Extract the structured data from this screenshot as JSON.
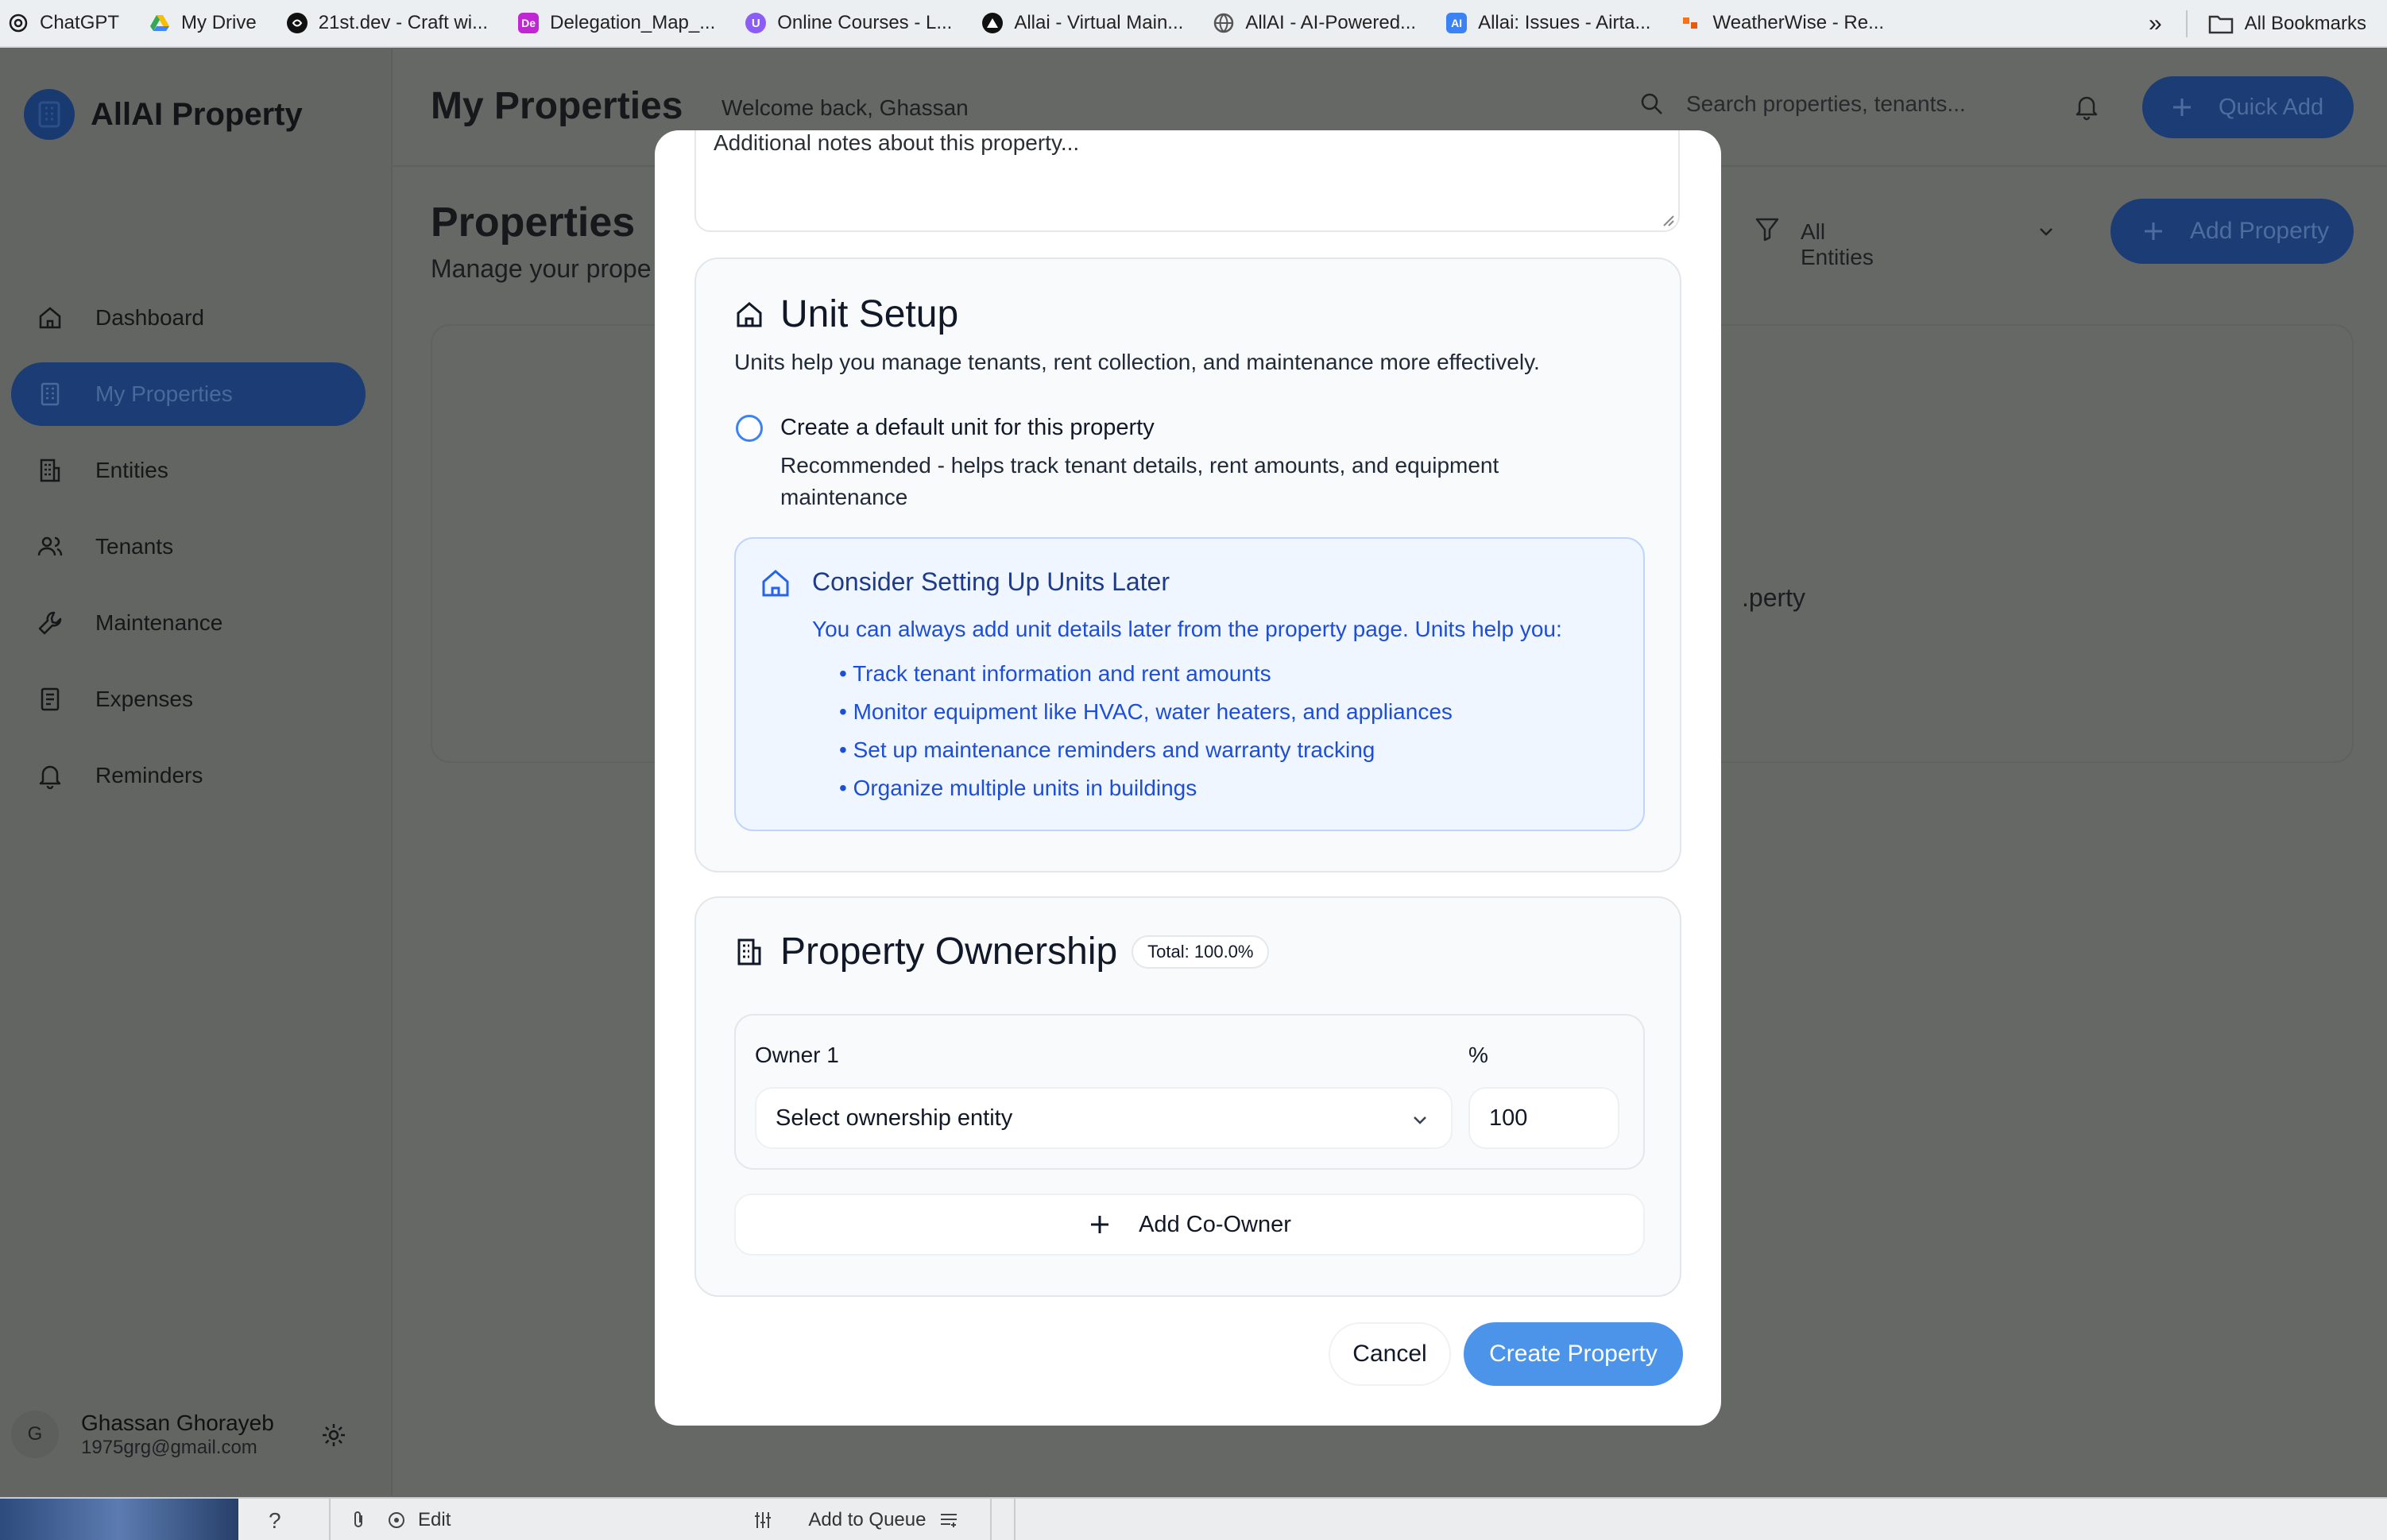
{
  "bookmarks": [
    {
      "label": "ChatGPT",
      "icon": "openai-icon",
      "color": "#1a1a1a"
    },
    {
      "label": "My Drive",
      "icon": "drive-icon",
      "color": "#34a853"
    },
    {
      "label": "21st.dev - Craft wi...",
      "icon": "21st-icon",
      "color": "#111111"
    },
    {
      "label": "Delegation_Map_...",
      "icon": "De",
      "color": "#c026d3"
    },
    {
      "label": "Online Courses - L...",
      "icon": "U",
      "color": "#8b5cf6"
    },
    {
      "label": "Allai - Virtual Main...",
      "icon": "triangle-icon",
      "color": "#111111"
    },
    {
      "label": "AllAI - AI-Powered...",
      "icon": "globe-icon",
      "color": "#555555"
    },
    {
      "label": "Allai: Issues - Airta...",
      "icon": "AI",
      "color": "#3b82f6"
    },
    {
      "label": "WeatherWise - Re...",
      "icon": "weather-icon",
      "color": "#f97316"
    }
  ],
  "bookmarks_more": "»",
  "all_bookmarks": "All Bookmarks",
  "brand": {
    "name": "AllAI Property"
  },
  "nav": [
    {
      "label": "Dashboard",
      "icon": "home-icon"
    },
    {
      "label": "My Properties",
      "icon": "building-icon",
      "active": true
    },
    {
      "label": "Entities",
      "icon": "entities-icon"
    },
    {
      "label": "Tenants",
      "icon": "users-icon"
    },
    {
      "label": "Maintenance",
      "icon": "wrench-icon"
    },
    {
      "label": "Expenses",
      "icon": "receipt-icon"
    },
    {
      "label": "Reminders",
      "icon": "bell-icon"
    }
  ],
  "user": {
    "initial": "G",
    "name": "Ghassan Ghorayeb",
    "email": "1975grg@gmail.com"
  },
  "header": {
    "title": "My Properties",
    "welcome": "Welcome back, Ghassan",
    "search_placeholder": "Search properties, tenants...",
    "quick_add": "Quick Add"
  },
  "content": {
    "title": "Properties",
    "subtitle": "Manage your prope",
    "filter_value": "All Entities",
    "add_property": "Add Property",
    "empty_fragment": "perty."
  },
  "modal": {
    "notes_placeholder": "Additional notes about this property...",
    "unit_setup": {
      "title": "Unit Setup",
      "description": "Units help you manage tenants, rent collection, and maintenance more effectively.",
      "option_label": "Create a default unit for this property",
      "option_desc": "Recommended - helps track tenant details, rent amounts, and equipment maintenance",
      "info_title": "Consider Setting Up Units Later",
      "info_text": "You can always add unit details later from the property page. Units help you:",
      "info_items": [
        "• Track tenant information and rent amounts",
        "• Monitor equipment like HVAC, water heaters, and appliances",
        "• Set up maintenance reminders and warranty tracking",
        "• Organize multiple units in buildings"
      ]
    },
    "ownership": {
      "title": "Property Ownership",
      "total_badge": "Total: 100.0%",
      "owner_label": "Owner 1",
      "percent_label": "%",
      "select_placeholder": "Select ownership entity",
      "percent_value": "100",
      "add_co_owner": "Add Co-Owner"
    },
    "cancel": "Cancel",
    "create": "Create Property"
  },
  "taskbar": {
    "help": "?",
    "edit": "Edit",
    "add_to_queue": "Add to Queue"
  },
  "colors": {
    "primary": "#4c94ea",
    "info_bg": "#eff6ff",
    "info_text": "#1d4ed8",
    "overlay_sidebar": "#626562"
  }
}
